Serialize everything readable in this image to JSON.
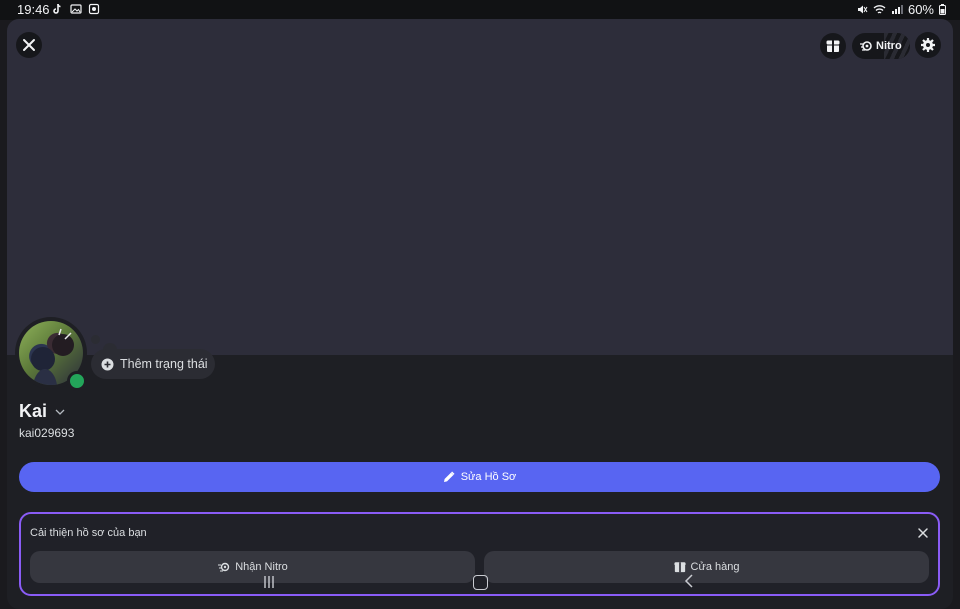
{
  "status_bar": {
    "time": "19:46",
    "battery": "60%",
    "left_icons": [
      "tiktok-icon",
      "gallery-icon",
      "notification-icon"
    ],
    "right_icons": [
      "mute-icon",
      "wifi-icon",
      "signal-icon",
      "battery-icon"
    ]
  },
  "header": {
    "close_icon": "close-icon",
    "shop_icon": "shop-icon",
    "nitro_label": "Nitro",
    "settings_icon": "gear-icon"
  },
  "profile": {
    "add_status_label": "Thêm trạng thái",
    "display_name": "Kai",
    "username": "kai029693",
    "online_color": "#23a55a"
  },
  "actions": {
    "edit_profile_label": "Sửa Hồ Sơ",
    "accent_color": "#5865f2"
  },
  "improve_card": {
    "title": "Cải thiện hồ sơ của bạn",
    "nitro_button_label": "Nhận Nitro",
    "shop_button_label": "Cửa hàng",
    "border_color": "#8a5cf6"
  },
  "nav_bar": {
    "items": [
      "recent-apps-icon",
      "home-icon",
      "back-icon"
    ]
  }
}
